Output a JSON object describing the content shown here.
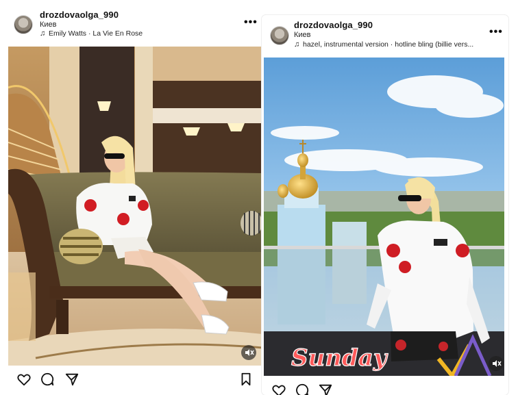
{
  "posts": [
    {
      "username": "drozdovaolga_990",
      "location": "Киев",
      "music": "Emily Watts · La Vie En Rose",
      "icons": {
        "more": "more-options-icon",
        "like": "heart-icon",
        "comment": "comment-icon",
        "share": "send-icon",
        "save": "bookmark-icon",
        "mute": "audio-muted-icon"
      }
    },
    {
      "username": "drozdovaolga_990",
      "location": "Киев",
      "music": "hazel, instrumental version · hotline bling (billie vers...",
      "overlay_text": "Sunday",
      "icons": {
        "more": "more-options-icon",
        "like": "heart-icon",
        "comment": "comment-icon",
        "share": "send-icon",
        "mute": "audio-muted-icon"
      }
    }
  ],
  "colors": {
    "sunday_text": "#ff5a5a",
    "sky": "#8cc1ee",
    "dome_gold": "#d8a937"
  }
}
